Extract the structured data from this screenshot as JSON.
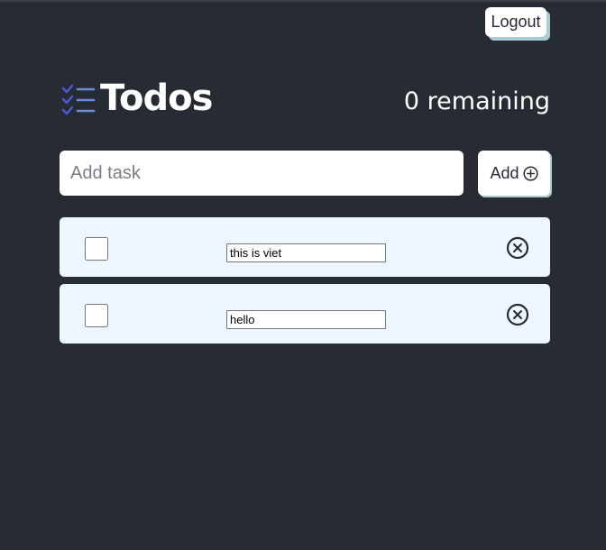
{
  "header": {
    "logout_label": "Logout",
    "title": "Todos",
    "remaining_text": "0 remaining",
    "logo_icon": "checklist-icon"
  },
  "add_form": {
    "placeholder": "Add task",
    "value": "",
    "add_label": "Add",
    "add_icon": "plus-circle-icon"
  },
  "tasks": [
    {
      "text": "this is viet",
      "completed": false
    },
    {
      "text": "hello",
      "completed": false
    }
  ],
  "colors": {
    "background": "#272b33",
    "task_background": "#eef6ff",
    "button_shadow": "#a9cbd3",
    "logo_accent": "#4a5bd8",
    "logo_lines": "#6f8bd6"
  }
}
